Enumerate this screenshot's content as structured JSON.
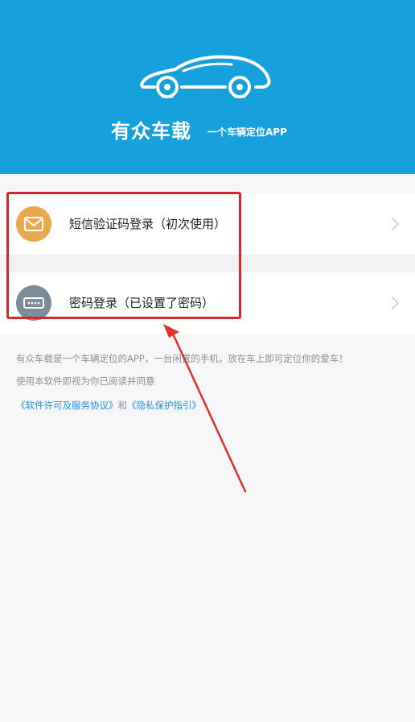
{
  "header": {
    "brand_name": "有众车载",
    "slogan": "一个车辆定位APP",
    "logo": "car-logo",
    "background_color": "#16a0dc"
  },
  "login_options": [
    {
      "icon": "envelope-icon",
      "label": "短信验证码登录（初次使用）",
      "icon_color": "#e8a84e"
    },
    {
      "icon": "password-icon",
      "label": "密码登录（已设置了密码）",
      "icon_color": "#7d8c99"
    }
  ],
  "info": {
    "description": "有众车载是一个车辆定位的APP，一台闲置的手机，放在车上即可定位你的爱车！",
    "notice": "使用本软件即视为你已阅读并同意",
    "license_link": "《软件许可及服务协议》",
    "conjunction": "和",
    "privacy_link": "《隐私保护指引》"
  },
  "annotation": {
    "color": "#d9262a"
  }
}
